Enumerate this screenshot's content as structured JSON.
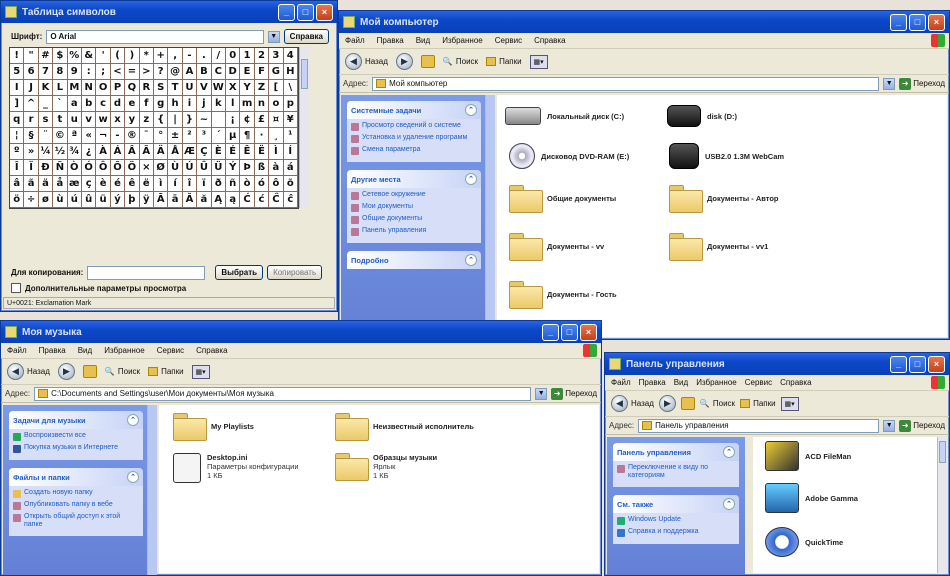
{
  "charmap": {
    "title": "Таблица символов",
    "font_label": "Шрифт:",
    "font_value": "O Arial",
    "help_button": "Справка",
    "grid_rows": [
      [
        "!",
        "\"",
        "#",
        "$",
        "%",
        "&",
        "'",
        "(",
        ")",
        "*",
        "+",
        ",",
        "-",
        ".",
        "/",
        "0",
        "1",
        "2",
        "3",
        "4"
      ],
      [
        "5",
        "6",
        "7",
        "8",
        "9",
        ":",
        ";",
        "<",
        "=",
        ">",
        "?",
        "@",
        "A",
        "B",
        "C",
        "D",
        "E",
        "F",
        "G",
        "H"
      ],
      [
        "I",
        "J",
        "K",
        "L",
        "M",
        "N",
        "O",
        "P",
        "Q",
        "R",
        "S",
        "T",
        "U",
        "V",
        "W",
        "X",
        "Y",
        "Z",
        "[",
        "\\"
      ],
      [
        "]",
        "^",
        "_",
        "`",
        "a",
        "b",
        "c",
        "d",
        "e",
        "f",
        "g",
        "h",
        "i",
        "j",
        "k",
        "l",
        "m",
        "n",
        "o",
        "p"
      ],
      [
        "q",
        "r",
        "s",
        "t",
        "u",
        "v",
        "w",
        "x",
        "y",
        "z",
        "{",
        "|",
        "}",
        "~",
        " ",
        "¡",
        "¢",
        "£",
        "¤",
        "¥"
      ],
      [
        "¦",
        "§",
        "¨",
        "©",
        "ª",
        "«",
        "¬",
        "-",
        "®",
        "¯",
        "°",
        "±",
        "²",
        "³",
        "´",
        "µ",
        "¶",
        "·",
        "¸",
        "¹"
      ],
      [
        "º",
        "»",
        "¼",
        "½",
        "¾",
        "¿",
        "À",
        "Á",
        "Â",
        "Ã",
        "Ä",
        "Å",
        "Æ",
        "Ç",
        "È",
        "É",
        "Ê",
        "Ë",
        "Ì",
        "Í"
      ],
      [
        "Î",
        "Ï",
        "Ð",
        "Ñ",
        "Ò",
        "Ó",
        "Ô",
        "Õ",
        "Ö",
        "×",
        "Ø",
        "Ù",
        "Ú",
        "Û",
        "Ü",
        "Ý",
        "Þ",
        "ß",
        "à",
        "á"
      ],
      [
        "â",
        "ã",
        "ä",
        "å",
        "æ",
        "ç",
        "è",
        "é",
        "ê",
        "ë",
        "ì",
        "í",
        "î",
        "ï",
        "ð",
        "ñ",
        "ò",
        "ó",
        "ô",
        "õ"
      ],
      [
        "ö",
        "÷",
        "ø",
        "ù",
        "ú",
        "û",
        "ü",
        "ý",
        "þ",
        "ÿ",
        "Ā",
        "ā",
        "Ă",
        "ă",
        "Ą",
        "ą",
        "Ć",
        "ć",
        "Ĉ",
        "ĉ"
      ]
    ],
    "copy_label": "Для копирования:",
    "select_button": "Выбрать",
    "copy_button": "Копировать",
    "advanced_checkbox": "Дополнительные параметры просмотра",
    "status": "U+0021: Exclamation Mark"
  },
  "mycomputer": {
    "title": "Мой компьютер",
    "menu": [
      "Файл",
      "Правка",
      "Вид",
      "Избранное",
      "Сервис",
      "Справка"
    ],
    "toolbar": {
      "back": "Назад",
      "search": "Поиск",
      "folders": "Папки"
    },
    "address_label": "Адрес:",
    "address_value": "Мой компьютер",
    "go_label": "Переход",
    "panels": [
      {
        "title": "Системные задачи",
        "items": [
          "Просмотр сведений о системе",
          "Установка и удаление программ",
          "Смена параметра"
        ]
      },
      {
        "title": "Другие места",
        "items": [
          "Сетевое окружение",
          "Мои документы",
          "Общие документы",
          "Панель управления"
        ]
      },
      {
        "title": "Подробно",
        "items": []
      }
    ],
    "items": [
      {
        "label": "Локальный диск (C:)",
        "icon": "hard-drive-icon"
      },
      {
        "label": "disk (D:)",
        "icon": "camera-drive-icon"
      },
      {
        "label": "Дисковод DVD-RAM (E:)",
        "icon": "dvd-drive-icon"
      },
      {
        "label": "USB2.0 1.3M WebCam",
        "icon": "webcam-icon"
      },
      {
        "label": "Общие документы",
        "icon": "folder-icon"
      },
      {
        "label": "Документы - Автор",
        "icon": "folder-icon"
      },
      {
        "label": "Документы - vv",
        "icon": "folder-icon"
      },
      {
        "label": "Документы - vv1",
        "icon": "folder-icon"
      },
      {
        "label": "Документы - Гость",
        "icon": "folder-icon"
      }
    ]
  },
  "mymusic": {
    "title": "Моя музыка",
    "menu": [
      "Файл",
      "Правка",
      "Вид",
      "Избранное",
      "Сервис",
      "Справка"
    ],
    "toolbar": {
      "back": "Назад",
      "search": "Поиск",
      "folders": "Папки"
    },
    "address_label": "Адрес:",
    "address_value": "C:\\Documents and Settings\\user\\Мои документы\\Моя музыка",
    "go_label": "Переход",
    "panels": [
      {
        "title": "Задачи для музыки",
        "items": [
          "Воспроизвести все",
          "Покупка музыки в Интернете"
        ]
      },
      {
        "title": "Файлы и папки",
        "items": [
          "Создать новую папку",
          "Опубликовать папку в вебе",
          "Открыть общий доступ к этой папке"
        ]
      }
    ],
    "items": [
      {
        "label": "My Playlists",
        "sub": "",
        "icon": "folder-icon"
      },
      {
        "label": "Неизвестный исполнитель",
        "sub": "",
        "icon": "folder-icon"
      },
      {
        "label": "Desktop.ini",
        "sub": "Параметры конфигурации\n1 КБ",
        "icon": "settings-file-icon"
      },
      {
        "label": "Образцы музыки",
        "sub": "Ярлык\n1 КБ",
        "icon": "shortcut-folder-icon"
      }
    ]
  },
  "controlpanel": {
    "title": "Панель управления",
    "menu": [
      "Файл",
      "Правка",
      "Вид",
      "Избранное",
      "Сервис",
      "Справка"
    ],
    "toolbar": {
      "back": "Назад",
      "search": "Поиск",
      "folders": "Папки"
    },
    "address_label": "Адрес:",
    "address_value": "Панель управления",
    "go_label": "Переход",
    "panels": [
      {
        "title": "Панель управления",
        "items": [
          "Переключение к виду по категориям"
        ]
      },
      {
        "title": "См. также",
        "items": [
          "Windows Update",
          "Справка и поддержка"
        ]
      }
    ],
    "items": [
      {
        "label": "ACD FileMan",
        "icon": "acd-icon"
      },
      {
        "label": "Adobe Gamma",
        "icon": "adobe-gamma-icon"
      },
      {
        "label": "QuickTime",
        "icon": "quicktime-icon"
      }
    ]
  }
}
